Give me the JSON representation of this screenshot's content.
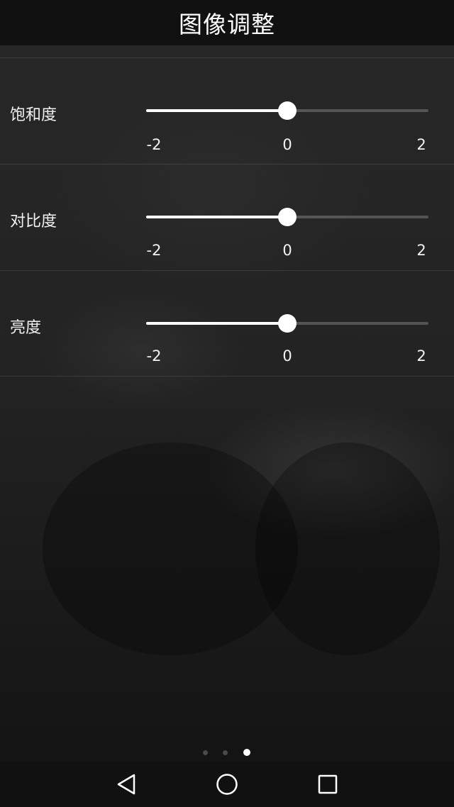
{
  "header": {
    "title": "图像调整"
  },
  "adjustments": [
    {
      "label": "饱和度",
      "min_label": "-2",
      "mid_label": "0",
      "max_label": "2",
      "min": -2,
      "max": 2,
      "value": 0
    },
    {
      "label": "对比度",
      "min_label": "-2",
      "mid_label": "0",
      "max_label": "2",
      "min": -2,
      "max": 2,
      "value": 0
    },
    {
      "label": "亮度",
      "min_label": "-2",
      "mid_label": "0",
      "max_label": "2",
      "min": -2,
      "max": 2,
      "value": 0
    }
  ],
  "pager": {
    "count": 3,
    "active_index": 2
  },
  "navbar": {
    "back_icon": "back-triangle-icon",
    "home_icon": "home-circle-icon",
    "recents_icon": "recents-square-icon"
  },
  "colors": {
    "accent": "#ffffff",
    "track_inactive": "#3a3a3a",
    "background": "#141414"
  }
}
